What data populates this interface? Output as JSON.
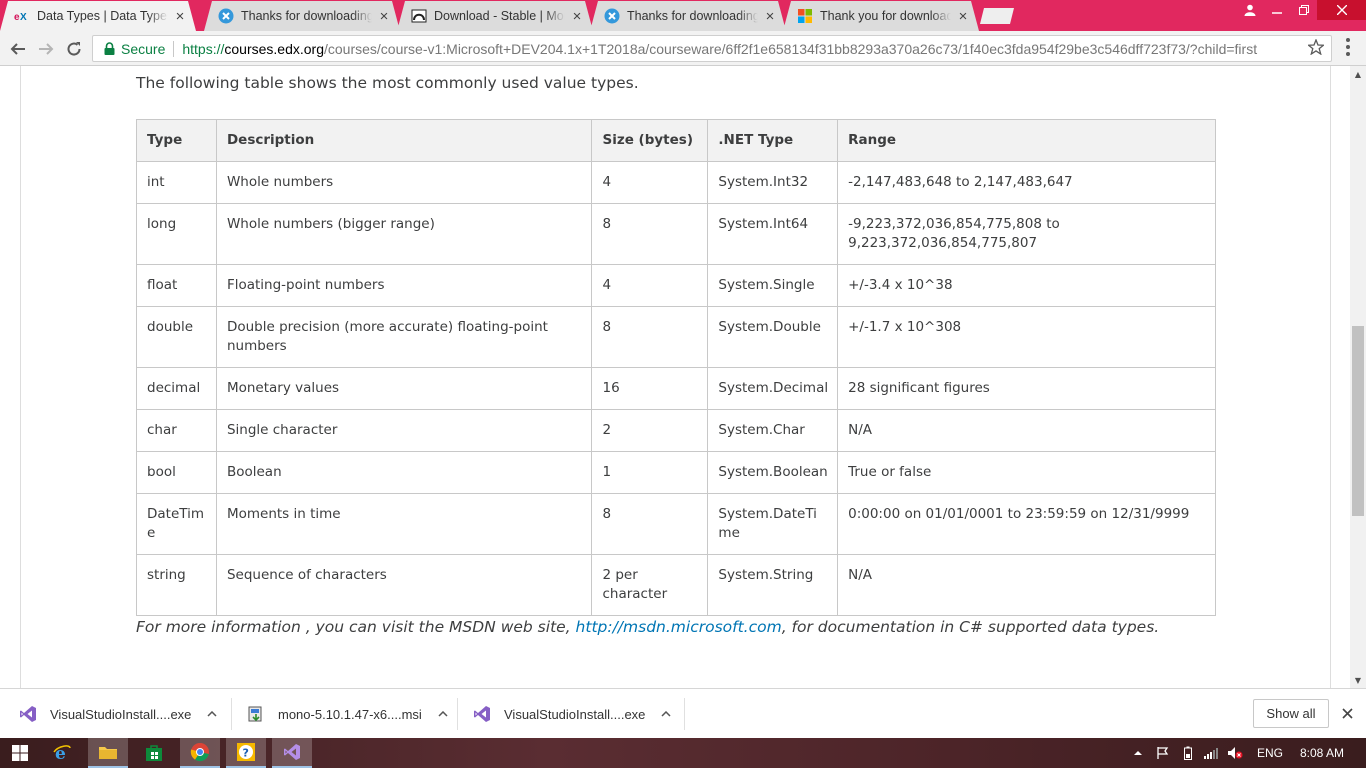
{
  "browser": {
    "tabs": [
      {
        "title": "Data Types | Data Types",
        "favicon": "edx-logo-icon",
        "active": true
      },
      {
        "title": "Thanks for downloading",
        "favicon": "xamarin-x-icon",
        "active": false
      },
      {
        "title": "Download - Stable | Mon",
        "favicon": "mono-monkey-icon",
        "active": false
      },
      {
        "title": "Thanks for downloading",
        "favicon": "xamarin-x-icon",
        "active": false
      },
      {
        "title": "Thank you for downloadi",
        "favicon": "microsoft-logo-icon",
        "active": false
      }
    ],
    "address": {
      "secure_label": "Secure",
      "url_proto": "https://",
      "url_host": "courses.edx.org",
      "url_rest": "/courses/course-v1:Microsoft+DEV204.1x+1T2018a/courseware/6ff2f1e658134f31bb8293a370a26c73/1f40ec3fda954f29be3c546dff723f73/?child=first"
    }
  },
  "page": {
    "intro": "The following table shows the most commonly used value types.",
    "table": {
      "headers": [
        "Type",
        "Description",
        "Size (bytes)",
        ".NET Type",
        "Range"
      ],
      "rows": [
        [
          "int",
          "Whole numbers",
          "4",
          "System.Int32",
          "-2,147,483,648 to 2,147,483,647"
        ],
        [
          "long",
          "Whole numbers (bigger range)",
          "8",
          "System.Int64",
          "-9,223,372,036,854,775,808 to 9,223,372,036,854,775,807"
        ],
        [
          "float",
          "Floating-point numbers",
          "4",
          "System.Single",
          "+/-3.4 x 10^38"
        ],
        [
          "double",
          "Double precision (more accurate) floating-point numbers",
          "8",
          "System.Double",
          "+/-1.7 x 10^308"
        ],
        [
          "decimal",
          "Monetary values",
          "16",
          "System.Decimal",
          "28 significant figures"
        ],
        [
          "char",
          "Single character",
          "2",
          "System.Char",
          "N/A"
        ],
        [
          "bool",
          "Boolean",
          "1",
          "System.Boolean",
          "True or false"
        ],
        [
          "DateTime",
          "Moments in time",
          "8",
          "System.DateTime",
          "0:00:00 on 01/01/0001 to 23:59:59 on 12/31/9999"
        ],
        [
          "string",
          "Sequence of characters",
          "2 per character",
          "System.String",
          "N/A"
        ]
      ]
    },
    "footnote": {
      "before": "For more information , you can visit the MSDN web site, ",
      "link": "http://msdn.microsoft.com",
      "after": ", for documentation in C# supported data types."
    }
  },
  "downloads": {
    "items": [
      {
        "name": "VisualStudioInstall....exe",
        "icon": "visual-studio-icon"
      },
      {
        "name": "mono-5.10.1.47-x6....msi",
        "icon": "msi-installer-icon"
      },
      {
        "name": "VisualStudioInstall....exe",
        "icon": "visual-studio-icon"
      }
    ],
    "show_all": "Show all"
  },
  "taskbar": {
    "language": "ENG",
    "time": "8:08 AM"
  },
  "colors": {
    "tab_strip": "#e1285f",
    "secure_green": "#0b8043",
    "link_blue": "#0075b4",
    "table_header_bg": "#f2f2f2"
  }
}
